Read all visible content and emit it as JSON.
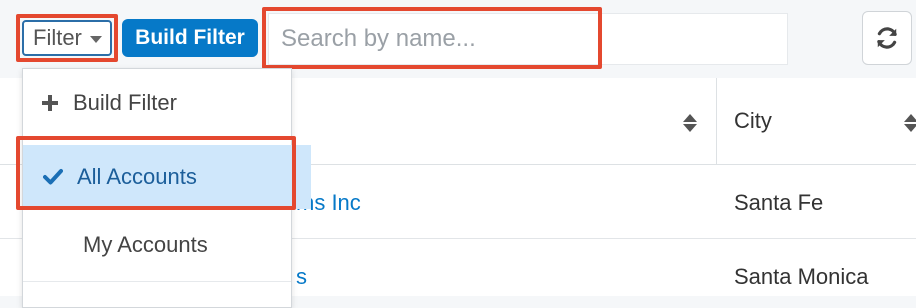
{
  "toolbar": {
    "filter_label": "Filter",
    "build_filter_label": "Build Filter",
    "search_placeholder": "Search by name..."
  },
  "table": {
    "headers": {
      "city": "City"
    },
    "rows": [
      {
        "name": "ms Inc",
        "city": "Santa Fe"
      },
      {
        "name": "s",
        "city": "Santa Monica"
      }
    ]
  },
  "filter_menu": {
    "items": [
      {
        "label": "Build Filter",
        "icon": "plus-icon"
      },
      {
        "label": "All Accounts",
        "icon": "check-icon",
        "selected": true
      },
      {
        "label": "My Accounts"
      }
    ]
  },
  "colors": {
    "accent": "#0679c8",
    "highlight": "#e4482f",
    "selected_bg": "#cfe7fb"
  }
}
